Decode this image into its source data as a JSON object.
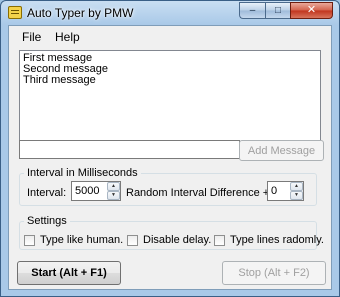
{
  "window": {
    "title": "Auto Typer by PMW",
    "icon": "app-keyboard-icon",
    "controls": {
      "minimize": "–",
      "maximize": "□",
      "close": "✕"
    }
  },
  "menu": {
    "file": "File",
    "help": "Help"
  },
  "messages": {
    "items": [
      "First message",
      "Second message",
      "Third message"
    ]
  },
  "add_message": {
    "input_value": "",
    "button_label": "Add Message"
  },
  "interval": {
    "group_label": "Interval in Milliseconds",
    "interval_label": "Interval:",
    "interval_value": "5000",
    "random_label": "Random Interval Difference +/-",
    "random_value": "0"
  },
  "settings": {
    "group_label": "Settings",
    "type_like_human": "Type like human.",
    "disable_delay": "Disable delay.",
    "type_lines_randomly": "Type lines radomly."
  },
  "actions": {
    "start_label": "Start  (Alt + F1)",
    "stop_label": "Stop  (Alt + F2)"
  }
}
